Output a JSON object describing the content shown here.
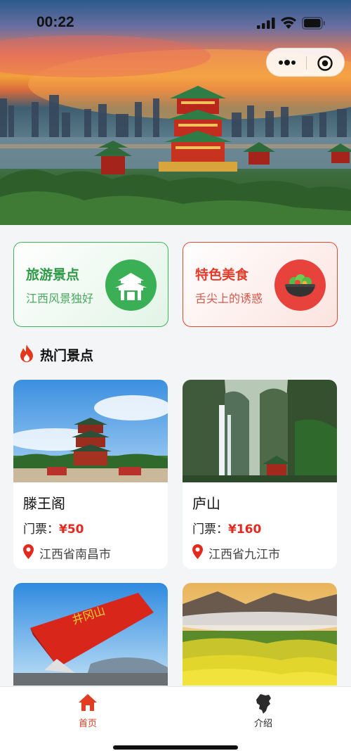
{
  "status_bar": {
    "time": "00:22"
  },
  "capsule": {
    "more_icon": "more-dots-icon",
    "close_icon": "target-close-icon"
  },
  "categories": [
    {
      "title": "旅游景点",
      "subtitle": "江西风景独好",
      "icon": "pavilion-icon",
      "accent": "#3aaf56"
    },
    {
      "title": "特色美食",
      "subtitle": "舌尖上的诱惑",
      "icon": "food-bowl-icon",
      "accent": "#e7433c"
    }
  ],
  "section": {
    "title": "热门景点",
    "icon": "fire-icon"
  },
  "spots": [
    {
      "name": "滕王阁",
      "ticket_label": "门票：",
      "price": "¥50",
      "location": "江西省南昌市"
    },
    {
      "name": "庐山",
      "ticket_label": "门票：",
      "price": "¥160",
      "location": "江西省九江市"
    },
    {
      "name": "",
      "ticket_label": "",
      "price": "",
      "location": ""
    },
    {
      "name": "",
      "ticket_label": "",
      "price": "",
      "location": ""
    }
  ],
  "landmark_text": "井冈山",
  "tabbar": {
    "items": [
      {
        "label": "首页",
        "icon": "home-icon",
        "active": true,
        "color": "#e23c23"
      },
      {
        "label": "介绍",
        "icon": "jiangxi-map-icon",
        "active": false,
        "color": "#222222"
      }
    ]
  },
  "colors": {
    "price_red": "#e3281d",
    "green_accent": "#3aaf56",
    "red_accent": "#e23c2a"
  }
}
